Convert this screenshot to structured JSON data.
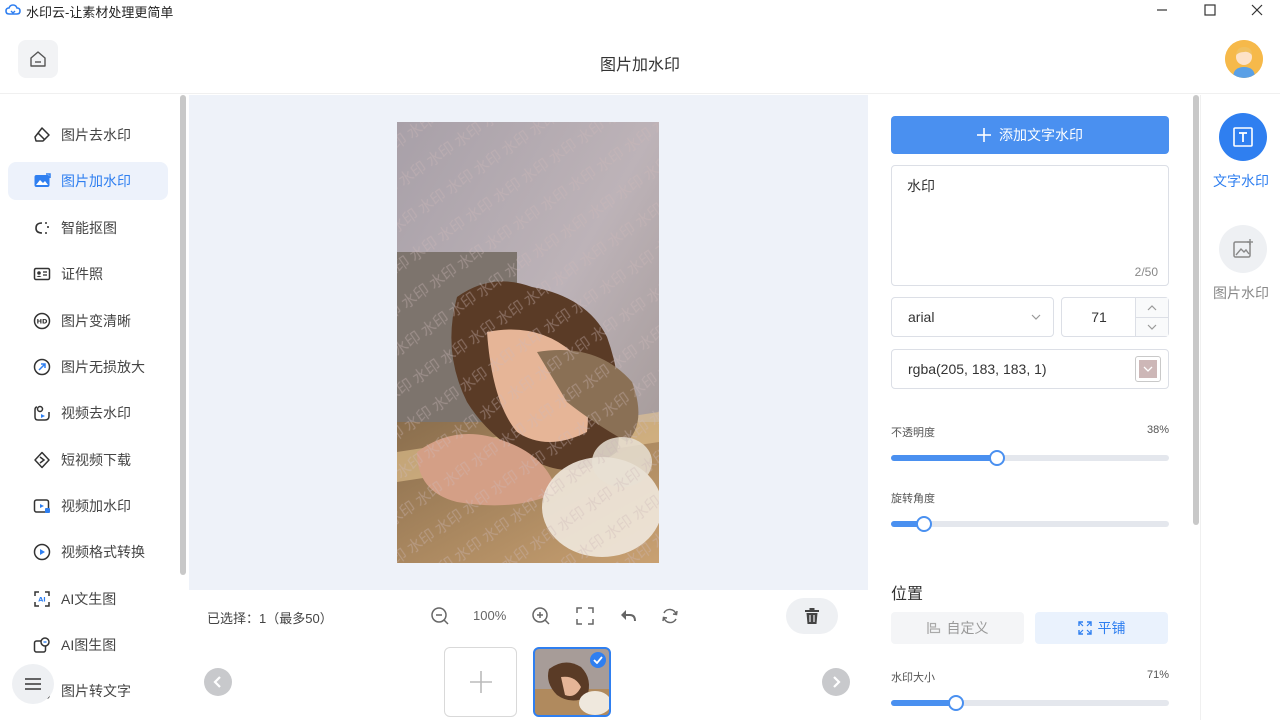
{
  "window": {
    "title": "水印云-让素材处理更简单",
    "minimize": "—",
    "maximize": "☐",
    "close": "✕"
  },
  "header": {
    "title": "图片加水印"
  },
  "sidebar": {
    "items": [
      {
        "label": "图片去水印",
        "icon": "eraser-icon"
      },
      {
        "label": "图片加水印",
        "icon": "image-edit-icon",
        "active": true
      },
      {
        "label": "智能抠图",
        "icon": "cutout-icon"
      },
      {
        "label": "证件照",
        "icon": "id-card-icon"
      },
      {
        "label": "图片变清晰",
        "icon": "hd-icon"
      },
      {
        "label": "图片无损放大",
        "icon": "enlarge-icon"
      },
      {
        "label": "视频去水印",
        "icon": "video-eraser-icon"
      },
      {
        "label": "短视频下载",
        "icon": "download-icon"
      },
      {
        "label": "视频加水印",
        "icon": "video-watermark-icon"
      },
      {
        "label": "视频格式转换",
        "icon": "video-convert-icon"
      },
      {
        "label": "AI文生图",
        "icon": "ai-text-image-icon"
      },
      {
        "label": "AI图生图",
        "icon": "ai-image-image-icon"
      },
      {
        "label": "图片转文字",
        "icon": "ocr-icon"
      }
    ]
  },
  "canvas": {
    "watermark_char": "水印"
  },
  "bottom": {
    "selected_text": "已选择：1（最多50）",
    "zoom": "100%"
  },
  "panel": {
    "add_button": "添加文字水印",
    "text_value": "水印",
    "counter": "2/50",
    "font": "arial",
    "font_size": "71",
    "color_text": "rgba(205, 183, 183, 1)",
    "color_hex": "#cdb7b7",
    "opacity_label": "不透明度",
    "opacity_value": "38%",
    "opacity_fraction": 0.38,
    "rotation_label": "旋转角度",
    "rotation_fraction": 0.12,
    "position_title": "位置",
    "custom_label": "自定义",
    "tile_label": "平铺",
    "size_label": "水印大小",
    "size_value": "71%",
    "size_fraction": 0.235
  },
  "rtabs": {
    "text_watermark": "文字水印",
    "image_watermark": "图片水印"
  },
  "colors": {
    "accent": "#2f7ff0",
    "button": "#4a90f0",
    "canvas_bg": "#eef2f9"
  }
}
